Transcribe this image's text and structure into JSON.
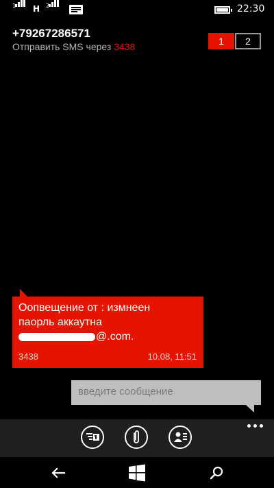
{
  "status_bar": {
    "sim1_index": "1",
    "sim2_index": "2",
    "network_type": "H",
    "time": "22:30",
    "icons": [
      "signal-icon",
      "signal-icon",
      "message-icon",
      "battery-icon"
    ]
  },
  "header": {
    "phone_number": "+79267286571",
    "send_via_prefix": "Отправить SMS через",
    "send_via_number": "3438",
    "sim_tabs": [
      {
        "label": "1",
        "selected": true
      },
      {
        "label": "2",
        "selected": false
      }
    ]
  },
  "message": {
    "line1": "Оопвещение от : измнеен",
    "line2": "паорль аккаутна",
    "line3_suffix": "@.com.",
    "sender": "3438",
    "timestamp": "10.08, 11:51"
  },
  "compose": {
    "placeholder": "введите сообщение"
  },
  "app_bar": {
    "buttons": [
      "switch-sim-icon",
      "attach-icon",
      "contact-card-icon"
    ],
    "more_icon": "more-icon"
  },
  "nav_bar": {
    "buttons": [
      "back-icon",
      "windows-icon",
      "search-icon"
    ]
  },
  "colors": {
    "accent": "#e51400",
    "background": "#000000",
    "app_bar": "#1f1f1f",
    "input_bg": "#bfbfbf"
  }
}
